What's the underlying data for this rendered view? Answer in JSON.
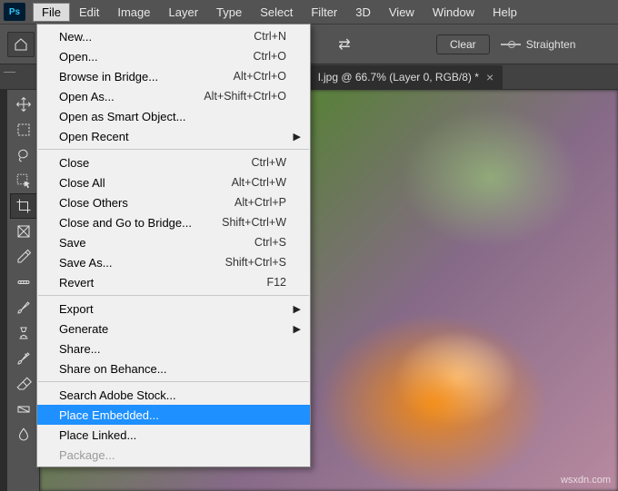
{
  "menubar": {
    "items": [
      "File",
      "Edit",
      "Image",
      "Layer",
      "Type",
      "Select",
      "Filter",
      "3D",
      "View",
      "Window",
      "Help"
    ]
  },
  "optionsbar": {
    "clear_label": "Clear",
    "straighten_label": "Straighten"
  },
  "tab": {
    "title": "l.jpg @ 66.7% (Layer 0, RGB/8) *"
  },
  "file_menu": {
    "groups": [
      [
        {
          "label": "New...",
          "shortcut": "Ctrl+N"
        },
        {
          "label": "Open...",
          "shortcut": "Ctrl+O"
        },
        {
          "label": "Browse in Bridge...",
          "shortcut": "Alt+Ctrl+O"
        },
        {
          "label": "Open As...",
          "shortcut": "Alt+Shift+Ctrl+O"
        },
        {
          "label": "Open as Smart Object..."
        },
        {
          "label": "Open Recent",
          "submenu": true
        }
      ],
      [
        {
          "label": "Close",
          "shortcut": "Ctrl+W"
        },
        {
          "label": "Close All",
          "shortcut": "Alt+Ctrl+W"
        },
        {
          "label": "Close Others",
          "shortcut": "Alt+Ctrl+P"
        },
        {
          "label": "Close and Go to Bridge...",
          "shortcut": "Shift+Ctrl+W"
        },
        {
          "label": "Save",
          "shortcut": "Ctrl+S"
        },
        {
          "label": "Save As...",
          "shortcut": "Shift+Ctrl+S"
        },
        {
          "label": "Revert",
          "shortcut": "F12"
        }
      ],
      [
        {
          "label": "Export",
          "submenu": true
        },
        {
          "label": "Generate",
          "submenu": true
        },
        {
          "label": "Share..."
        },
        {
          "label": "Share on Behance..."
        }
      ],
      [
        {
          "label": "Search Adobe Stock..."
        },
        {
          "label": "Place Embedded...",
          "highlight": true
        },
        {
          "label": "Place Linked..."
        },
        {
          "label": "Package...",
          "disabled": true
        }
      ]
    ]
  },
  "watermark": "wsxdn.com",
  "tools": [
    "move-tool",
    "marquee-tool",
    "lasso-tool",
    "object-select-tool",
    "crop-tool",
    "frame-tool",
    "eyedropper-tool",
    "healing-brush-tool",
    "brush-tool",
    "clone-stamp-tool",
    "history-brush-tool",
    "eraser-tool",
    "gradient-tool",
    "blur-tool"
  ]
}
